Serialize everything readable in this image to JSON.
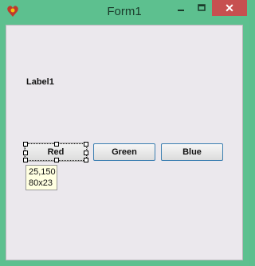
{
  "window": {
    "title": "Form1",
    "close_symbol": "✕"
  },
  "form": {
    "label1": "Label1",
    "buttons": {
      "red": "Red",
      "green": "Green",
      "blue": "Blue"
    }
  },
  "designer_tooltip": {
    "location": "25,150",
    "size": "80x23"
  },
  "colors": {
    "window_frame": "#5dc08f",
    "client_bg": "#ebe8ed",
    "close_button": "#c75050"
  },
  "icons": {
    "app": "app-icon",
    "minimize": "minimize-icon",
    "maximize": "maximize-icon",
    "close": "close-icon"
  }
}
